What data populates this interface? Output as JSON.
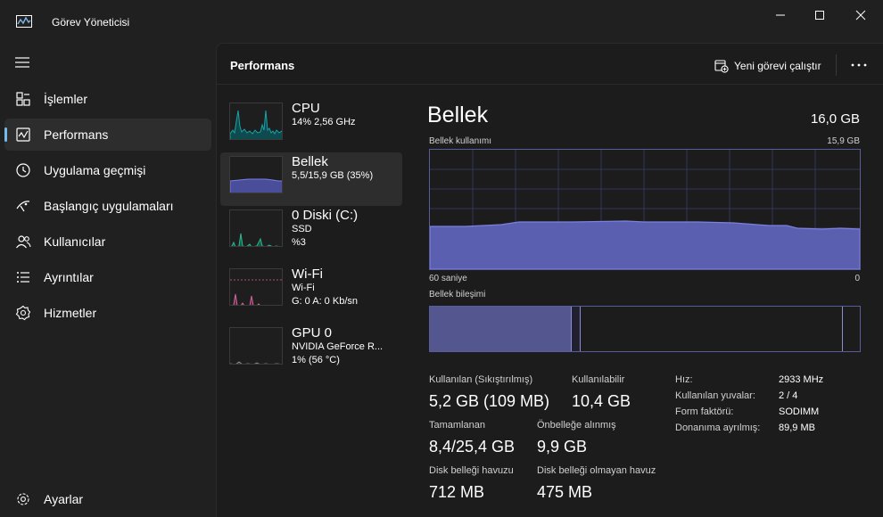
{
  "window": {
    "title": "Görev Yöneticisi"
  },
  "nav": {
    "items": [
      {
        "label": "İşlemler",
        "icon": "processes-icon"
      },
      {
        "label": "Performans",
        "icon": "performance-icon"
      },
      {
        "label": "Uygulama geçmişi",
        "icon": "history-icon"
      },
      {
        "label": "Başlangıç uygulamaları",
        "icon": "startup-icon"
      },
      {
        "label": "Kullanıcılar",
        "icon": "users-icon"
      },
      {
        "label": "Ayrıntılar",
        "icon": "details-icon"
      },
      {
        "label": "Hizmetler",
        "icon": "services-icon"
      }
    ],
    "settings_label": "Ayarlar"
  },
  "header": {
    "title": "Performans",
    "run_task_label": "Yeni görevi çalıştır"
  },
  "resources": [
    {
      "name": "CPU",
      "line1": "14% 2,56 GHz",
      "line2": "",
      "color": "#17a2a8"
    },
    {
      "name": "Bellek",
      "line1": "5,5/15,9 GB (35%)",
      "line2": "",
      "color": "#7b80e0"
    },
    {
      "name": "0 Diski (C:)",
      "line1": "SSD",
      "line2": "%3",
      "color": "#2eb891"
    },
    {
      "name": "Wi-Fi",
      "line1": "Wi-Fi",
      "line2": "G: 0 A: 0 Kb/sn",
      "color": "#d4639e"
    },
    {
      "name": "GPU 0",
      "line1": "NVIDIA GeForce R...",
      "line2": "1% (56 °C)",
      "color": "#7a7a7a"
    }
  ],
  "detail": {
    "title": "Bellek",
    "total": "16,0 GB",
    "usage_label": "Bellek kullanımı",
    "usage_max": "15,9 GB",
    "time_left": "60 saniye",
    "time_right": "0",
    "composition_label": "Bellek bileşimi",
    "usage_fraction": 0.35,
    "composition": {
      "in_use": 0.33,
      "modified": 0.02,
      "standby": 0.61,
      "free": 0.04
    },
    "graph_color": "#7b80e0"
  },
  "stats": {
    "in_use_label": "Kullanılan (Sıkıştırılmış)",
    "in_use_value": "5,2 GB (109 MB)",
    "available_label": "Kullanılabilir",
    "available_value": "10,4 GB",
    "committed_label": "Tamamlanan",
    "committed_value": "8,4/25,4 GB",
    "cached_label": "Önbelleğe alınmış",
    "cached_value": "9,9 GB",
    "paged_label": "Disk belleği havuzu",
    "paged_value": "712 MB",
    "nonpaged_label": "Disk belleği olmayan havuz",
    "nonpaged_value": "475 MB"
  },
  "specs": [
    {
      "key": "Hız:",
      "value": "2933 MHz"
    },
    {
      "key": "Kullanılan yuvalar:",
      "value": "2 / 4"
    },
    {
      "key": "Form faktörü:",
      "value": "SODIMM"
    },
    {
      "key": "Donanıma ayrılmış:",
      "value": "89,9 MB"
    }
  ]
}
